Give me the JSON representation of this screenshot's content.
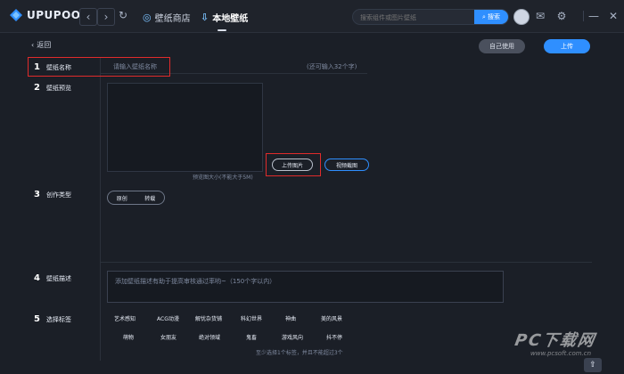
{
  "app": {
    "logo_text": "UPUPOO",
    "brand_color": "#2f8fff"
  },
  "topbar": {
    "nav_back_icon": "chevron-left-icon",
    "nav_forward_icon": "chevron-right-icon",
    "refresh_icon": "refresh-icon",
    "wallpaper_store_label": "壁纸商店",
    "local_wallpaper_label": "本地壁纸",
    "search_placeholder": "搜索组件或图片壁纸",
    "search_button_label": "搜索"
  },
  "header": {
    "back_label": "返回",
    "use_self_label": "自己使用",
    "upload_label": "上传"
  },
  "form": {
    "name": {
      "num": "1",
      "label": "壁纸名称",
      "placeholder": "请输入壁纸名称",
      "hint": "(还可输入32个字)"
    },
    "preview": {
      "num": "2",
      "label": "壁纸预览",
      "upload_pic_label": "上传图片",
      "video_screenshot_label": "视频截图",
      "tip": "预览图大小(不能大于5M)"
    },
    "type": {
      "num": "3",
      "label": "创作类型",
      "options": [
        "原创",
        "转载"
      ]
    },
    "desc": {
      "num": "4",
      "label": "壁纸描述",
      "placeholder": "添加壁纸描述有助于提高审核通过率哟~（150个字以内）"
    },
    "tags": {
      "num": "5",
      "label": "选择标签",
      "row1": [
        "艺术感知",
        "ACG动漫",
        "解忧杂货铺",
        "科幻世界",
        "神曲",
        "美的风景"
      ],
      "row2": [
        "萌物",
        "女朋友",
        "绝对领域",
        "鬼畜",
        "游戏风向",
        "抖不停"
      ],
      "note": "至少选择1个标签，并且不能超过3个"
    }
  },
  "watermark": {
    "text": "PC下载网",
    "url": "www.pcsoft.com.cn"
  }
}
